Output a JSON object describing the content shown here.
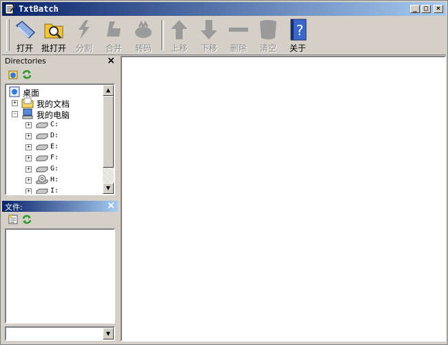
{
  "window": {
    "title": "TxtBatch"
  },
  "toolbar": {
    "buttons": [
      {
        "label": "打开",
        "icon": "open-folder-icon",
        "enabled": true
      },
      {
        "label": "批打开",
        "icon": "batch-open-icon",
        "enabled": true
      },
      {
        "label": "分割",
        "icon": "split-icon",
        "enabled": false
      },
      {
        "label": "合并",
        "icon": "merge-icon",
        "enabled": false
      },
      {
        "label": "转码",
        "icon": "convert-icon",
        "enabled": false
      },
      {
        "label": "上移",
        "icon": "arrow-up-icon",
        "enabled": false
      },
      {
        "label": "下移",
        "icon": "arrow-down-icon",
        "enabled": false
      },
      {
        "label": "删除",
        "icon": "delete-icon",
        "enabled": false
      },
      {
        "label": "清空",
        "icon": "clear-icon",
        "enabled": false
      },
      {
        "label": "关于",
        "icon": "about-icon",
        "enabled": true
      }
    ]
  },
  "directories": {
    "title": "Directories",
    "tree": [
      {
        "label": "桌面",
        "level": 0
      },
      {
        "label": "我的文档",
        "level": 1
      },
      {
        "label": "我的电脑",
        "level": 1
      },
      {
        "label": "C:",
        "level": 2
      },
      {
        "label": "D:",
        "level": 2
      },
      {
        "label": "E:",
        "level": 2
      },
      {
        "label": "F:",
        "level": 2
      },
      {
        "label": "G:",
        "level": 2
      },
      {
        "label": "H:",
        "level": 2
      },
      {
        "label": "I:",
        "level": 2
      }
    ]
  },
  "files": {
    "title": "文件:",
    "filter_value": ""
  },
  "colors": {
    "titlebar_start": "#0a246a",
    "titlebar_end": "#a6caf0",
    "face": "#d4d0c8"
  }
}
